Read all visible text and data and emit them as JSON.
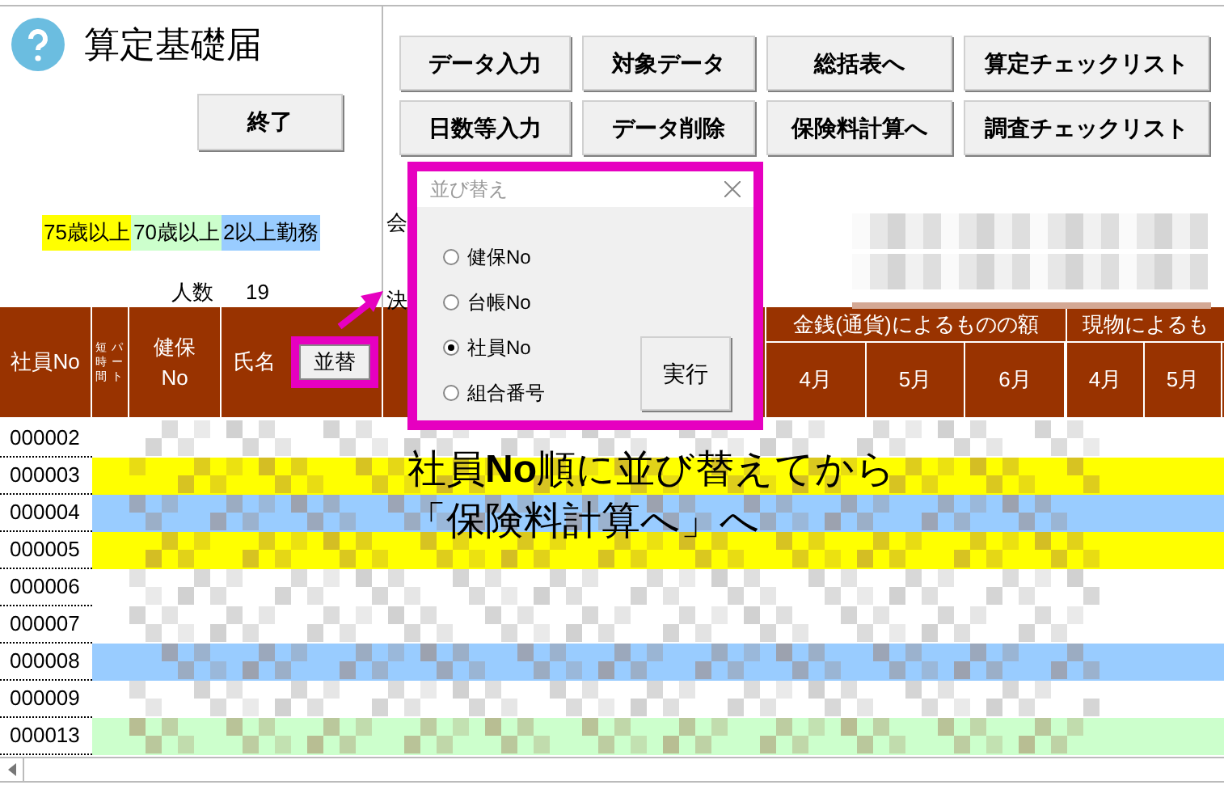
{
  "title": "算定基礎届",
  "exit_button": "終了",
  "legend": [
    {
      "label": "75歳以上",
      "color": "#ffff00"
    },
    {
      "label": "70歳以上",
      "color": "#ccffcc"
    },
    {
      "label": "2以上勤務",
      "color": "#99ccff"
    }
  ],
  "headcount": {
    "label": "人数",
    "value": "19"
  },
  "side_labels": [
    "会",
    "決"
  ],
  "toolbar": [
    [
      "データ入力",
      "対象データ",
      "総括表へ",
      "算定チェックリスト"
    ],
    [
      "日数等入力",
      "データ削除",
      "保険料計算へ",
      "調査チェックリスト"
    ]
  ],
  "table": {
    "columns": [
      {
        "label": "社員No"
      },
      {
        "label": "短時間"
      },
      {
        "label": "パート"
      },
      {
        "label": "健保No"
      },
      {
        "label": "氏名"
      }
    ],
    "sort_button": "並替",
    "groups": [
      {
        "label": "金銭(通貨)によるものの額",
        "months": [
          "4月",
          "5月",
          "6月"
        ]
      },
      {
        "label": "現物によるも",
        "months": [
          "4月",
          "5月"
        ]
      }
    ],
    "rows": [
      {
        "id": "000002"
      },
      {
        "id": "000003",
        "color": "#ffff00"
      },
      {
        "id": "000004",
        "color": "#99ccff"
      },
      {
        "id": "000005",
        "color": "#ffff00"
      },
      {
        "id": "000006"
      },
      {
        "id": "000007"
      },
      {
        "id": "000008",
        "color": "#99ccff"
      },
      {
        "id": "000009"
      },
      {
        "id": "000013",
        "color": "#ccffcc"
      }
    ]
  },
  "dialog": {
    "title": "並び替え",
    "options": [
      {
        "label": "健保No",
        "selected": false
      },
      {
        "label": "台帳No",
        "selected": false
      },
      {
        "label": "社員No",
        "selected": true
      },
      {
        "label": "組合番号",
        "selected": false
      }
    ],
    "run_button": "実行"
  },
  "annotation": [
    "社員**No**順に並び替えてから",
    "「保険料計算へ」へ"
  ]
}
